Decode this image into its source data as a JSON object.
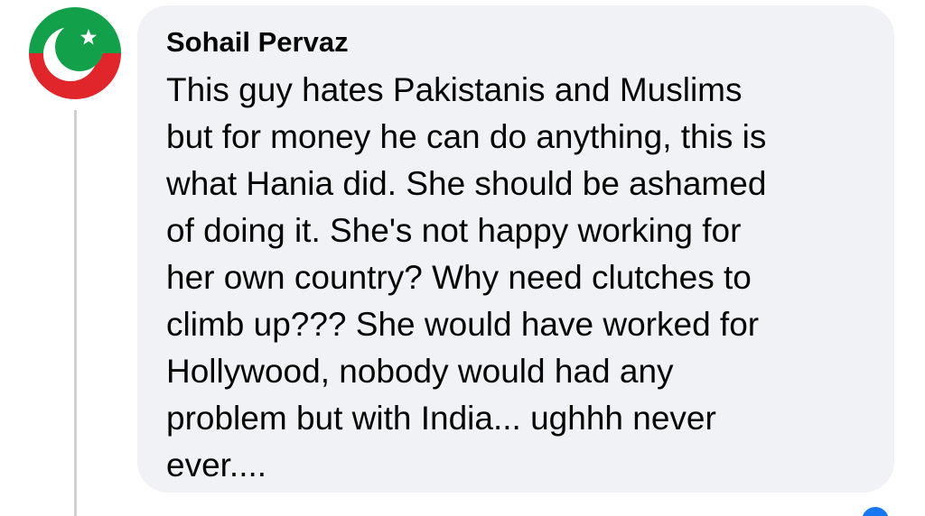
{
  "comment": {
    "author": "Sohail Pervaz",
    "text": "This guy hates Pakistanis and Muslims\nbut for money he can do anything, this is\nwhat Hania did. She should be ashamed\nof doing it. She's not happy working for\nher own country? Why need clutches to\nclimb up??? She would have worked for\nHollywood, nobody would had any\nproblem but with India... ughhh never\never...."
  },
  "avatar": {
    "icon": "crescent-star-flag-icon",
    "colors": {
      "top": "#12a14a",
      "bottom": "#e0262b",
      "symbol": "#ffffff"
    }
  },
  "colors": {
    "bubble": "#f0f2f5",
    "text": "#050505",
    "thread_line": "#ced0d4",
    "reaction": "#1877f2"
  }
}
